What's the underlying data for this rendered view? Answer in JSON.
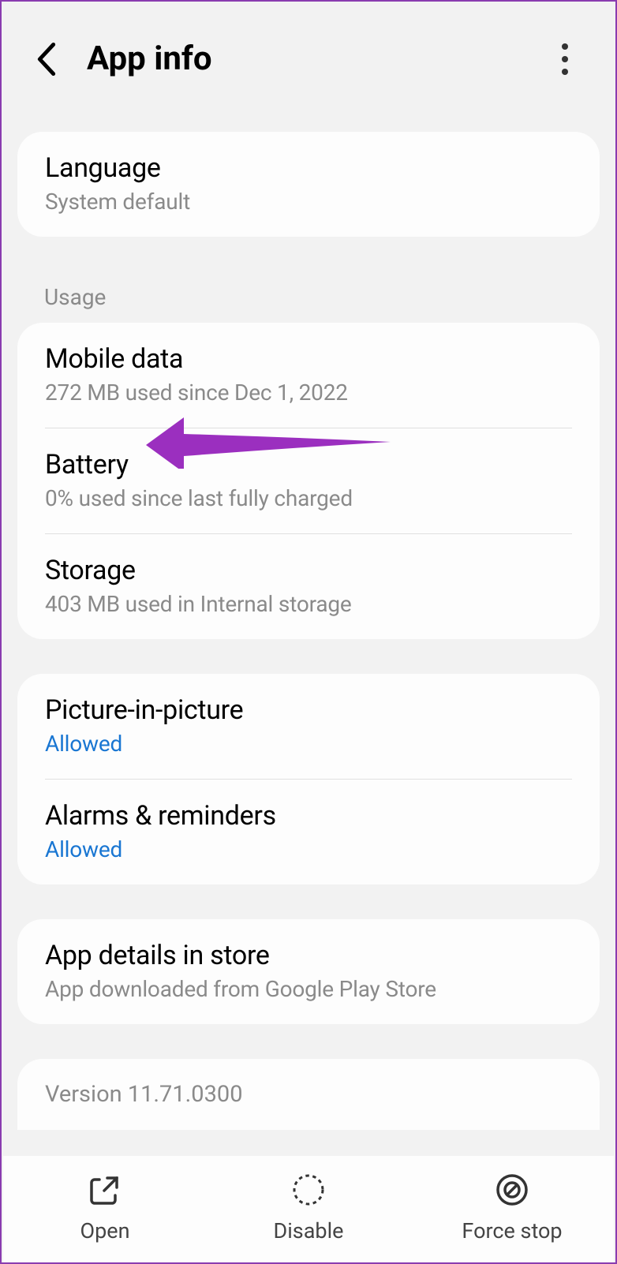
{
  "header": {
    "title": "App info"
  },
  "section1": {
    "items": [
      {
        "title": "Language",
        "subtitle": "System default"
      }
    ]
  },
  "usage_header": "Usage",
  "section_usage": {
    "items": [
      {
        "title": "Mobile data",
        "subtitle": "272 MB used since Dec 1, 2022"
      },
      {
        "title": "Battery",
        "subtitle": "0% used since last fully charged"
      },
      {
        "title": "Storage",
        "subtitle": "403 MB used in Internal storage"
      }
    ]
  },
  "section_perms": {
    "items": [
      {
        "title": "Picture-in-picture",
        "subtitle": "Allowed"
      },
      {
        "title": "Alarms & reminders",
        "subtitle": "Allowed"
      }
    ]
  },
  "section_store": {
    "items": [
      {
        "title": "App details in store",
        "subtitle": "App downloaded from Google Play Store"
      }
    ]
  },
  "version": "Version 11.71.0300",
  "bottom": {
    "items": [
      {
        "label": "Open"
      },
      {
        "label": "Disable"
      },
      {
        "label": "Force stop"
      }
    ]
  }
}
